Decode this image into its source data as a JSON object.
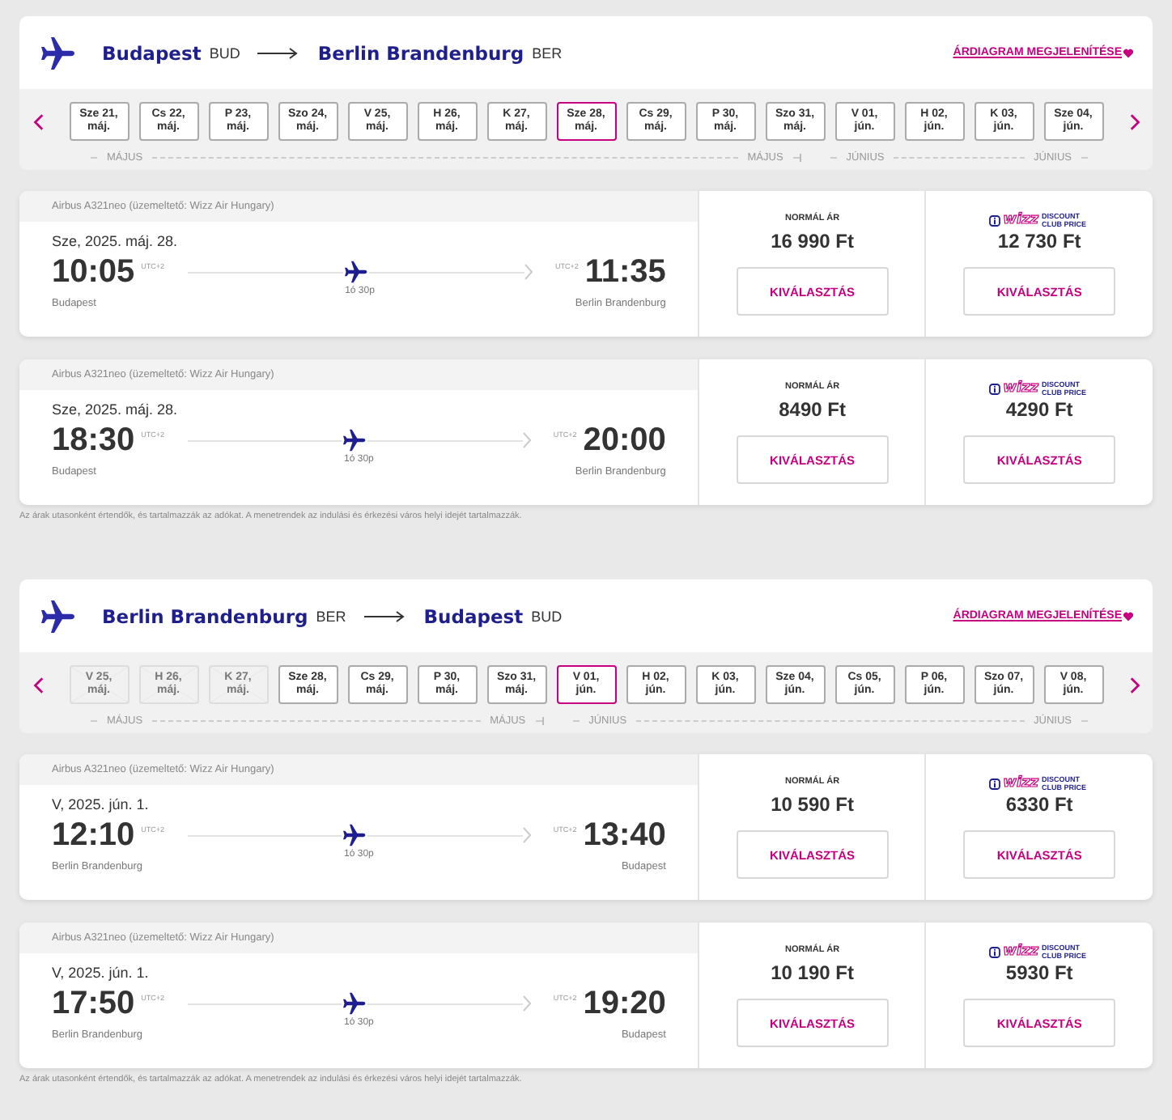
{
  "sections": [
    {
      "origin": "Budapest",
      "origin_code": "BUD",
      "destination": "Berlin Brandenburg",
      "destination_code": "BER",
      "chart_link": "ÁRDIAGRAM MEGJELENÍTÉSE",
      "month_groups": [
        {
          "labels": [
            "MÁJUS",
            "MÁJUS"
          ],
          "dates": [
            {
              "day": "Sze 21,",
              "month": "máj.",
              "selected": false,
              "disabled": false
            },
            {
              "day": "Cs 22,",
              "month": "máj.",
              "selected": false,
              "disabled": false
            },
            {
              "day": "P 23,",
              "month": "máj.",
              "selected": false,
              "disabled": false
            },
            {
              "day": "Szo 24,",
              "month": "máj.",
              "selected": false,
              "disabled": false
            },
            {
              "day": "V 25,",
              "month": "máj.",
              "selected": false,
              "disabled": false
            },
            {
              "day": "H 26,",
              "month": "máj.",
              "selected": false,
              "disabled": false
            },
            {
              "day": "K 27,",
              "month": "máj.",
              "selected": false,
              "disabled": false
            },
            {
              "day": "Sze 28,",
              "month": "máj.",
              "selected": true,
              "disabled": false
            },
            {
              "day": "Cs 29,",
              "month": "máj.",
              "selected": false,
              "disabled": false
            },
            {
              "day": "P 30,",
              "month": "máj.",
              "selected": false,
              "disabled": false
            },
            {
              "day": "Szo 31,",
              "month": "máj.",
              "selected": false,
              "disabled": false
            }
          ]
        },
        {
          "labels": [
            "JÚNIUS",
            "JÚNIUS"
          ],
          "dates": [
            {
              "day": "V 01,",
              "month": "jún.",
              "selected": false,
              "disabled": false
            },
            {
              "day": "H 02,",
              "month": "jún.",
              "selected": false,
              "disabled": false
            },
            {
              "day": "K 03,",
              "month": "jún.",
              "selected": false,
              "disabled": false
            },
            {
              "day": "Sze 04,",
              "month": "jún.",
              "selected": false,
              "disabled": false
            }
          ]
        }
      ],
      "flights": [
        {
          "aircraft": "Airbus A321neo (üzemeltető: Wizz Air Hungary)",
          "date": "Sze, 2025. máj. 28.",
          "dep_time": "10:05",
          "dep_tz": "UTC+2",
          "dep_city": "Budapest",
          "duration": "1ó 30p",
          "arr_tz": "UTC+2",
          "arr_time": "11:35",
          "arr_city": "Berlin Brandenburg",
          "normal_label": "NORMÁL ÁR",
          "normal_price": "16 990 Ft",
          "normal_select": "KIVÁLASZTÁS",
          "club_logo": "wizz",
          "club_label": "DISCOUNT CLUB PRICE",
          "club_price": "12 730 Ft",
          "club_select": "KIVÁLASZTÁS"
        },
        {
          "aircraft": "Airbus A321neo (üzemeltető: Wizz Air Hungary)",
          "date": "Sze, 2025. máj. 28.",
          "dep_time": "18:30",
          "dep_tz": "UTC+2",
          "dep_city": "Budapest",
          "duration": "1ó 30p",
          "arr_tz": "UTC+2",
          "arr_time": "20:00",
          "arr_city": "Berlin Brandenburg",
          "normal_label": "NORMÁL ÁR",
          "normal_price": "8490 Ft",
          "normal_select": "KIVÁLASZTÁS",
          "club_logo": "wizz",
          "club_label": "DISCOUNT CLUB PRICE",
          "club_price": "4290 Ft",
          "club_select": "KIVÁLASZTÁS"
        }
      ],
      "note": "Az árak utasonként értendők, és tartalmazzák az adókat. A menetrendek az indulási és érkezési város helyi idejét tartalmazzák."
    },
    {
      "origin": "Berlin Brandenburg",
      "origin_code": "BER",
      "destination": "Budapest",
      "destination_code": "BUD",
      "chart_link": "ÁRDIAGRAM MEGJELENÍTÉSE",
      "month_groups": [
        {
          "labels": [
            "MÁJUS",
            "MÁJUS"
          ],
          "dates": [
            {
              "day": "V 25,",
              "month": "máj.",
              "selected": false,
              "disabled": true
            },
            {
              "day": "H 26,",
              "month": "máj.",
              "selected": false,
              "disabled": true
            },
            {
              "day": "K 27,",
              "month": "máj.",
              "selected": false,
              "disabled": true
            },
            {
              "day": "Sze 28,",
              "month": "máj.",
              "selected": false,
              "disabled": false
            },
            {
              "day": "Cs 29,",
              "month": "máj.",
              "selected": false,
              "disabled": false
            },
            {
              "day": "P 30,",
              "month": "máj.",
              "selected": false,
              "disabled": false
            },
            {
              "day": "Szo 31,",
              "month": "máj.",
              "selected": false,
              "disabled": false
            }
          ]
        },
        {
          "labels": [
            "JÚNIUS",
            "JÚNIUS"
          ],
          "dates": [
            {
              "day": "V 01,",
              "month": "jún.",
              "selected": true,
              "disabled": false
            },
            {
              "day": "H 02,",
              "month": "jún.",
              "selected": false,
              "disabled": false
            },
            {
              "day": "K 03,",
              "month": "jún.",
              "selected": false,
              "disabled": false
            },
            {
              "day": "Sze 04,",
              "month": "jún.",
              "selected": false,
              "disabled": false
            },
            {
              "day": "Cs 05,",
              "month": "jún.",
              "selected": false,
              "disabled": false
            },
            {
              "day": "P 06,",
              "month": "jún.",
              "selected": false,
              "disabled": false
            },
            {
              "day": "Szo 07,",
              "month": "jún.",
              "selected": false,
              "disabled": false
            },
            {
              "day": "V 08,",
              "month": "jún.",
              "selected": false,
              "disabled": false
            }
          ]
        }
      ],
      "flights": [
        {
          "aircraft": "Airbus A321neo (üzemeltető: Wizz Air Hungary)",
          "date": "V, 2025. jún. 1.",
          "dep_time": "12:10",
          "dep_tz": "UTC+2",
          "dep_city": "Berlin Brandenburg",
          "duration": "1ó 30p",
          "arr_tz": "UTC+2",
          "arr_time": "13:40",
          "arr_city": "Budapest",
          "normal_label": "NORMÁL ÁR",
          "normal_price": "10 590 Ft",
          "normal_select": "KIVÁLASZTÁS",
          "club_logo": "wizz",
          "club_label": "DISCOUNT CLUB PRICE",
          "club_price": "6330 Ft",
          "club_select": "KIVÁLASZTÁS"
        },
        {
          "aircraft": "Airbus A321neo (üzemeltető: Wizz Air Hungary)",
          "date": "V, 2025. jún. 1.",
          "dep_time": "17:50",
          "dep_tz": "UTC+2",
          "dep_city": "Berlin Brandenburg",
          "duration": "1ó 30p",
          "arr_tz": "UTC+2",
          "arr_time": "19:20",
          "arr_city": "Budapest",
          "normal_label": "NORMÁL ÁR",
          "normal_price": "10 190 Ft",
          "normal_select": "KIVÁLASZTÁS",
          "club_logo": "wizz",
          "club_label": "DISCOUNT CLUB PRICE",
          "club_price": "5930 Ft",
          "club_select": "KIVÁLASZTÁS"
        }
      ],
      "note": "Az árak utasonként értendők, és tartalmazzák az adókat. A menetrendek az indulási és érkezési város helyi idejét tartalmazzák."
    }
  ]
}
